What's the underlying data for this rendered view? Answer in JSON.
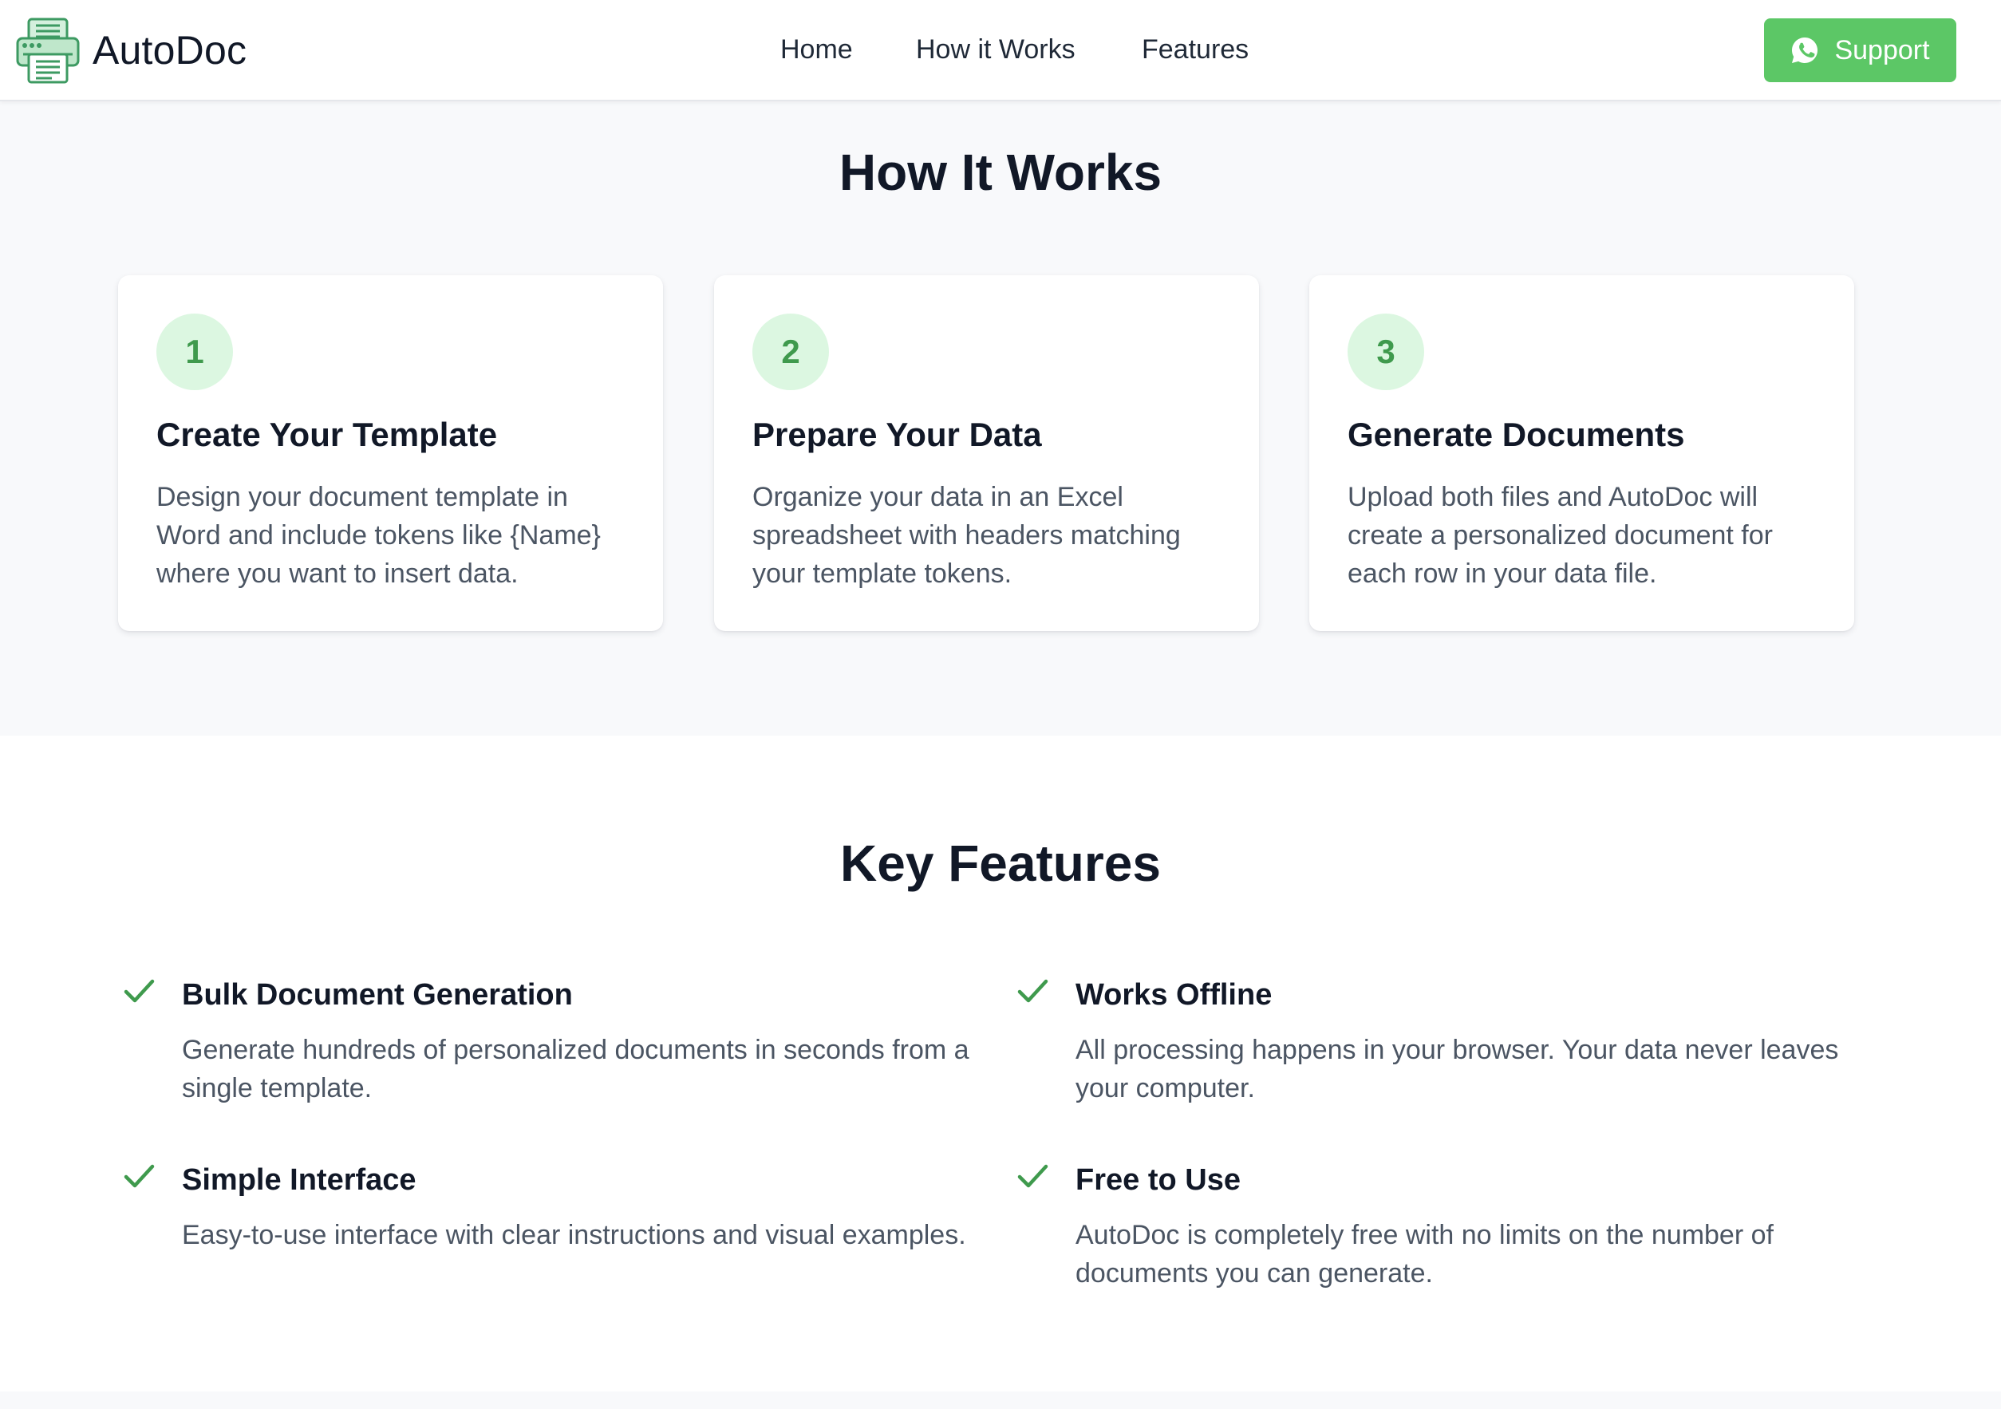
{
  "header": {
    "brand_name": "AutoDoc",
    "logo_icon": "printer-icon",
    "nav": [
      {
        "label": "Home"
      },
      {
        "label": "How it Works"
      },
      {
        "label": "Features"
      }
    ],
    "support": {
      "label": "Support",
      "icon": "whatsapp-icon",
      "color": "#5cc766"
    }
  },
  "how_it_works": {
    "title": "How It Works",
    "steps": [
      {
        "number": "1",
        "title": "Create Your Template",
        "description": "Design your document template in Word and include tokens like {Name} where you want to insert data."
      },
      {
        "number": "2",
        "title": "Prepare Your Data",
        "description": "Organize your data in an Excel spreadsheet with headers matching your template tokens."
      },
      {
        "number": "3",
        "title": "Generate Documents",
        "description": "Upload both files and AutoDoc will create a personalized document for each row in your data file."
      }
    ]
  },
  "features": {
    "title": "Key Features",
    "items": [
      {
        "title": "Bulk Document Generation",
        "description": "Generate hundreds of personalized documents in seconds from a single template."
      },
      {
        "title": "Works Offline",
        "description": "All processing happens in your browser. Your data never leaves your computer."
      },
      {
        "title": "Simple Interface",
        "description": "Easy-to-use interface with clear instructions and visual examples."
      },
      {
        "title": "Free to Use",
        "description": "AutoDoc is completely free with no limits on the number of documents you can generate."
      }
    ]
  },
  "colors": {
    "accent": "#5cc766",
    "check": "#3f9a4d",
    "step_badge_bg": "#dcf7e1",
    "section_bg": "#f8f9fb"
  }
}
